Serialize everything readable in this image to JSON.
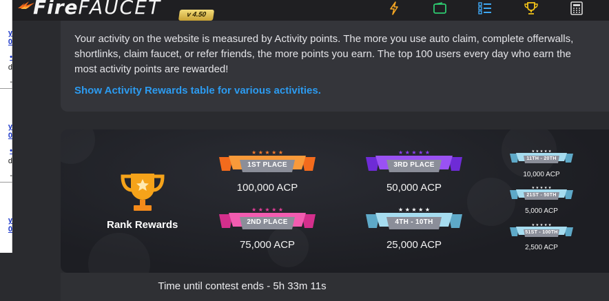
{
  "brand": {
    "name_part1": "Fire",
    "name_part2": "FAUCET",
    "version": "v 4.50"
  },
  "nav": {
    "icons": [
      "lightning-icon",
      "wallet-icon",
      "task-list-icon",
      "trophy-icon",
      "calculator-icon"
    ],
    "accent_colors": [
      "#f5a623",
      "#2ecc71",
      "#3fa9f5",
      "#f5c518",
      "#d8d8d8"
    ]
  },
  "left_strip": {
    "items": [
      {
        "link_a": "y",
        "link_b": "0",
        "dot": "•",
        "text": "d",
        "dash": "-"
      },
      {
        "link_a": "y",
        "link_b": "0",
        "dot": "•",
        "text": "d",
        "dash": "-"
      },
      {
        "link_a": "y",
        "link_b": "0"
      }
    ]
  },
  "info": {
    "line1": "Your activity on the website is measured by Activity points. The more you use auto claim, complete offerwalls,",
    "line2": "shortlinks, claim faucet, or refer friends, the more points you earn. The top 100 users every day who earn the",
    "line3": "most activity points are rewarded!",
    "link": "Show Activity Rewards table for various activities."
  },
  "rank_rewards": {
    "title": "Rank Rewards",
    "places": [
      {
        "place": "1ST PLACE",
        "prize": "100,000 ACP",
        "color": "#f47a2a"
      },
      {
        "place": "3RD PLACE",
        "prize": "50,000 ACP",
        "color": "#8a3ff0"
      },
      {
        "place": "2ND PLACE",
        "prize": "75,000 ACP",
        "color": "#e63c9a"
      },
      {
        "place": "4TH - 10TH",
        "prize": "25,000 ACP",
        "color": "#7fc4e0"
      },
      {
        "place": "11TH - 20TH",
        "prize": "10,000 ACP",
        "color": "#8fd0e8"
      },
      {
        "place": "21ST - 50TH",
        "prize": "5,000 ACP",
        "color": "#8fd0e8"
      },
      {
        "place": "51ST - 100TH",
        "prize": "2,500 ACP",
        "color": "#8fd0e8"
      }
    ]
  },
  "footer": {
    "countdown_text": "Time until contest ends - 5h 33m 11s"
  }
}
